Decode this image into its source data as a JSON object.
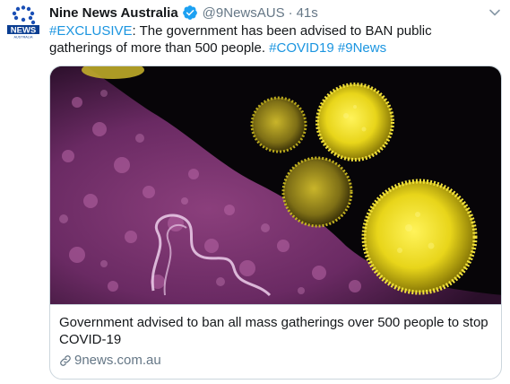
{
  "author": {
    "display_name": "Nine News Australia",
    "handle": "@9NewsAUS",
    "separator": "·",
    "timestamp": "41s",
    "verified": true,
    "avatar_text_top": "9",
    "avatar_text_bottom": "NEWS",
    "avatar_text_sub": "AUSTRALIA"
  },
  "tweet": {
    "hashtag_exclusive": "#EXCLUSIVE",
    "body": ": The government has been advised to BAN public gatherings of more than 500 people. ",
    "hashtag_covid": "#COVID19",
    "hashtag_space": " ",
    "hashtag_9news": "#9News"
  },
  "card": {
    "image_icon": "coronavirus-micrograph-image",
    "title": "Government advised to ban all mass gatherings over 500 people to stop COVID-19",
    "domain": "9news.com.au"
  },
  "colors": {
    "link": "#1b95e0",
    "verified": "#1da1f2",
    "muted": "#657786",
    "text": "#14171a",
    "border": "#ccd6dd",
    "avatar_bg": "#0a3d91"
  }
}
